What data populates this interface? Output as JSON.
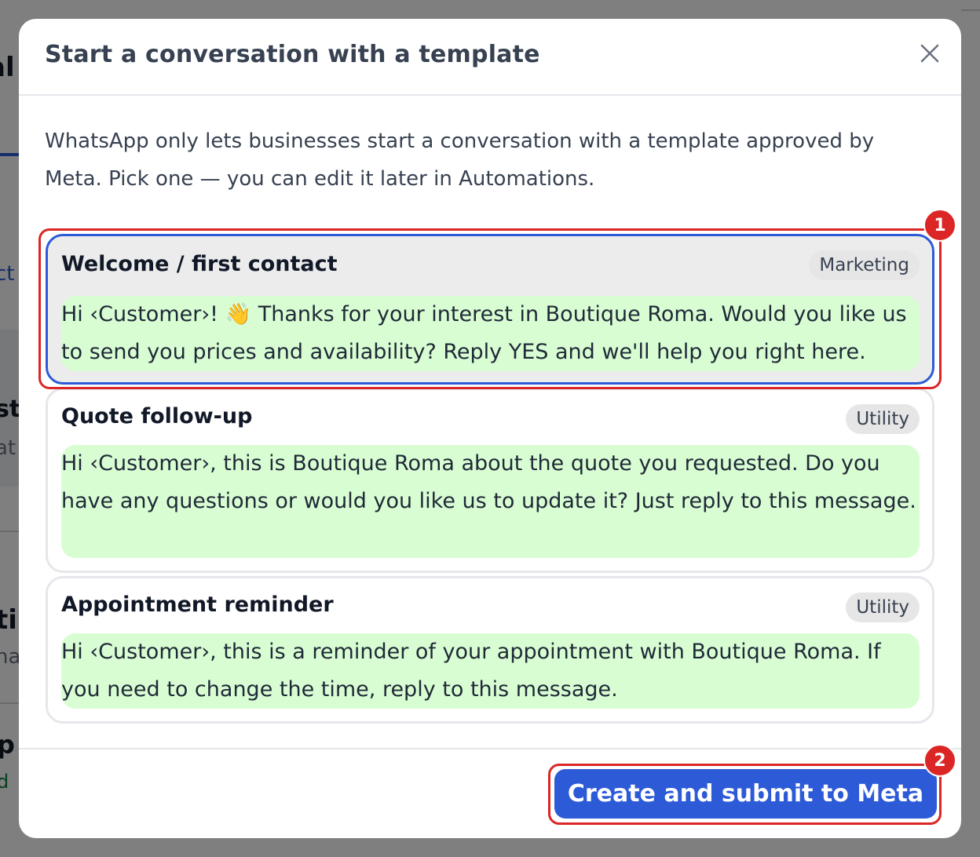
{
  "modal": {
    "title": "Start a conversation with a template",
    "intro": "WhatsApp only lets businesses start a conversation with a template approved by Meta. Pick one — you can edit it later in Automations.",
    "submit_label": "Create and submit to Meta"
  },
  "templates": [
    {
      "name": "Welcome / first contact",
      "category": "Marketing",
      "body": "Hi ‹Customer›! 👋  Thanks for your interest in Boutique Roma. Would you like us to send you prices and availability? Reply YES and we'll help you right here.",
      "selected": true
    },
    {
      "name": "Quote follow-up",
      "category": "Utility",
      "body": "Hi ‹Customer›, this is Boutique Roma about the quote you requested. Do you have any questions or would you like us to update it? Just reply to this message.",
      "selected": false
    },
    {
      "name": "Appointment reminder",
      "category": "Utility",
      "body": "Hi ‹Customer›, this is a reminder of your appointment with Boutique Roma. If you need to change the time, reply to this message.",
      "selected": false
    }
  ],
  "annotations": {
    "step1": "1",
    "step2": "2"
  },
  "background": {
    "frag1": "al",
    "frag2": "ct",
    "frag3": "st",
    "frag4": "at",
    "frag5": "ti",
    "frag6": "ha",
    "frag7": "p",
    "frag8": "d"
  },
  "colors": {
    "primary": "#2d5bd7",
    "message_bubble": "#d9fdd3",
    "annotation_red": "#dc2626",
    "selected_card_bg": "#ececec"
  },
  "icons": {
    "close": "close-icon"
  }
}
